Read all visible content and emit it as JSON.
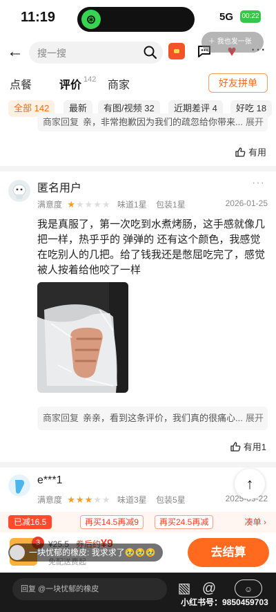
{
  "status": {
    "time": "11:19",
    "signal": "5G",
    "battery": "00:22"
  },
  "header": {
    "search_placeholder": "搜一搜",
    "tip": "我也发一张"
  },
  "tabs": [
    {
      "label": "点餐"
    },
    {
      "label": "评价",
      "count": "142"
    },
    {
      "label": "商家"
    }
  ],
  "friend_button": "好友拼单",
  "filters": [
    "全部 142",
    "最新",
    "有图/视频 32",
    "近期差评 4",
    "好吃 18"
  ],
  "prev_review": {
    "merchant_reply_label": "商家回复",
    "merchant_reply_text": "亲，非常抱歉因为我们的疏忽给你带来...",
    "unfold": "展开",
    "useful": "有用"
  },
  "review1": {
    "user": "匿名用户",
    "satisfaction_label": "满意度",
    "stars": 1,
    "taste": "味道1星",
    "pack": "包装1星",
    "date": "2026-01-25",
    "text": "我是真服了，第一次吃到水煮烤肠，这手感就像几把一样，热乎乎的 弹弹的 还有这个颜色，我感觉在吃别人的几把。给了钱我还是憋屈吃完了，感觉被人按着给他咬了一样",
    "merchant_reply_label": "商家回复",
    "merchant_reply_text": "亲亲，看到这条评价，我们真的很痛心...",
    "unfold": "展开",
    "useful": "有用1"
  },
  "review2": {
    "user": "e***1",
    "satisfaction_label": "满意度",
    "stars": 3,
    "taste": "味道3星",
    "pack": "包装5星",
    "date": "2025-09-22"
  },
  "promo": {
    "badge": "已减16.5",
    "chips": [
      "再买14.5再减9",
      "再买24.5再减"
    ],
    "more": "凑单 ›"
  },
  "cart": {
    "badge": "3",
    "original_price": "¥25.5",
    "after_coupon_label": "券后约",
    "after_coupon_price": "¥9",
    "fee_note": "免配送费起",
    "checkout": "去结算"
  },
  "float_comment": {
    "user": "一块忧郁的橡皮:",
    "text": "我求求了🥹🥹🥹"
  },
  "bottom": {
    "reply_placeholder": "回复 @一块忧郁的橡皮",
    "watermark": "小红书号：9850459703"
  },
  "colors": {
    "accent": "#f26a1b",
    "star": "#f89c24",
    "price": "#ef3c24"
  }
}
